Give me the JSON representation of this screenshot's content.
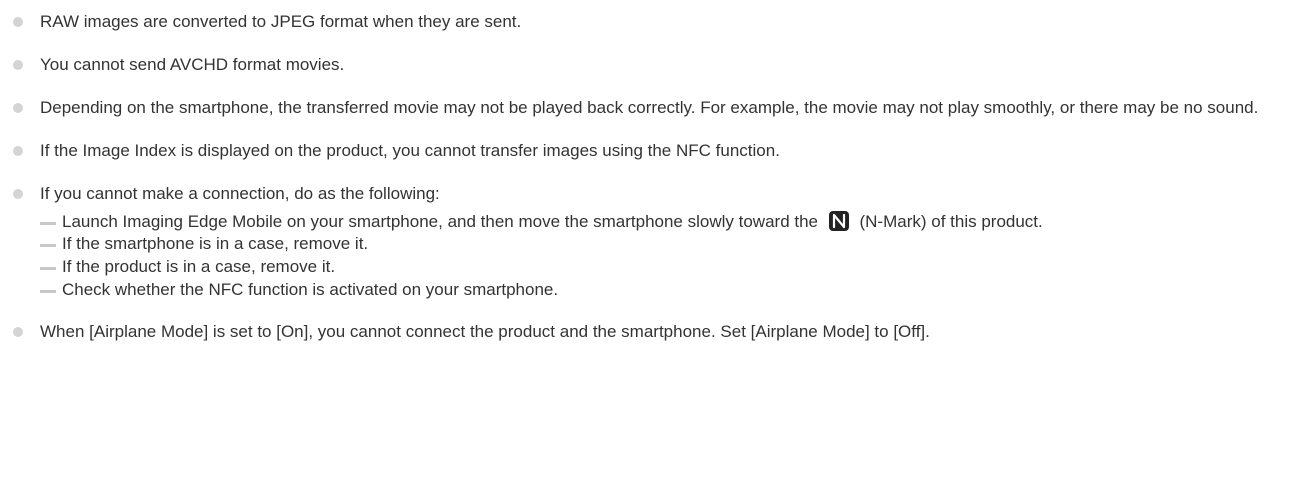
{
  "notes": [
    {
      "text": "RAW images are converted to JPEG format when they are sent."
    },
    {
      "text": "You cannot send AVCHD format movies."
    },
    {
      "text": "Depending on the smartphone, the transferred movie may not be played back correctly. For example, the movie may not play smoothly, or there may be no sound."
    },
    {
      "text": "If the Image Index is displayed on the product, you cannot transfer images using the NFC function."
    },
    {
      "text": "If you cannot make a connection, do as the following:",
      "subitems": [
        {
          "before": "Launch Imaging Edge Mobile on your smartphone, and then move the smartphone slowly toward the",
          "after": "(N-Mark) of this product."
        },
        {
          "text": "If the smartphone is in a case, remove it."
        },
        {
          "text": "If the product is in a case, remove it."
        },
        {
          "text": "Check whether the NFC function is activated on your smartphone."
        }
      ]
    },
    {
      "text": "When [Airplane Mode] is set to [On], you cannot connect the product and the smartphone. Set [Airplane Mode] to [Off]."
    }
  ],
  "icons": {
    "bullet": "bullet-dot-icon",
    "dash": "dash-icon",
    "nmark": "n-mark-icon"
  },
  "colors": {
    "text": "#333333",
    "bullet": "#d4d4d4",
    "dash": "#c8c8c8",
    "nmark": "#222222"
  }
}
